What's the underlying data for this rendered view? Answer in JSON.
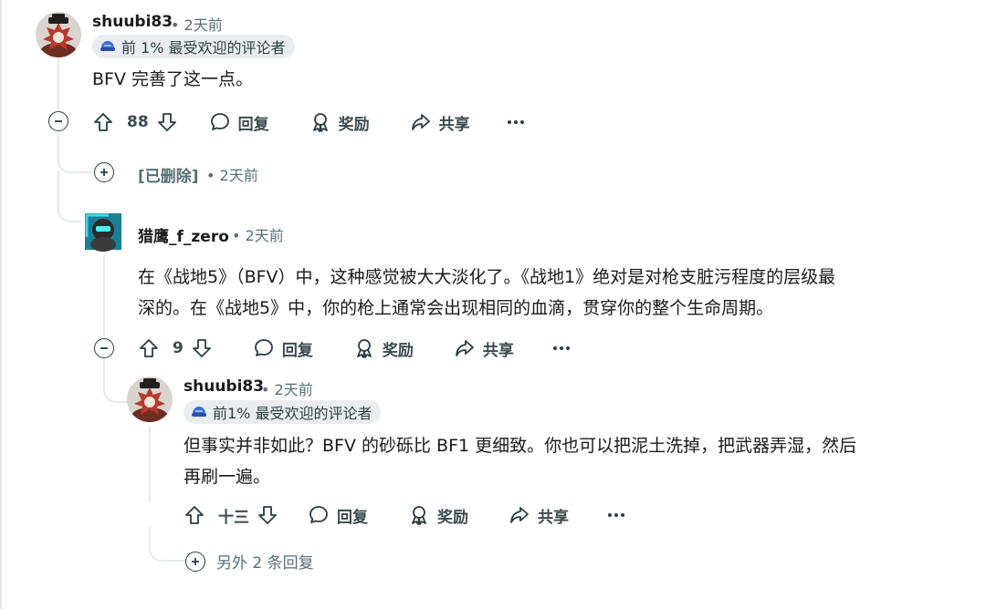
{
  "comments": [
    {
      "author": "shuubi83",
      "time": "• 2天前",
      "flair": "前 1% 最受欢迎的评论者",
      "body": "BFV 完善了这一点。",
      "votes": "88",
      "actions": {
        "reply": "回复",
        "award": "奖励",
        "share": "共享"
      }
    },
    {
      "deleted_label": "[已删除]",
      "time": "• 2天前"
    },
    {
      "author": "猎鹰_f_zero",
      "time": "• 2天前",
      "body_lines": [
        "在《战地5》（BFV）中，这种感觉被大大淡化了。《战地1》绝对是对枪支脏污程度的层级最",
        "深的。在《战地5》中，你的枪上通常会出现相同的血滴，贯穿你的整个生命周期。"
      ],
      "votes": "9",
      "actions": {
        "reply": "回复",
        "award": "奖励",
        "share": "共享"
      }
    },
    {
      "author": "shuubi83",
      "time": "• 2天前",
      "flair": "前1% 最受欢迎的评论者",
      "body_lines": [
        "但事实并非如此？BFV 的砂砾比 BF1 更细致。你也可以把泥土洗掉，把武器弄湿，然后",
        "再刷一遍。"
      ],
      "votes": "十三",
      "actions": {
        "reply": "回复",
        "award": "奖励",
        "share": "共享"
      }
    }
  ],
  "more_replies": "另外 2 条回复",
  "icons": {
    "upvote": "upvote-arrow-icon",
    "downvote": "downvote-arrow-icon",
    "reply": "speech-bubble-icon",
    "award": "award-ribbon-icon",
    "share": "share-arrow-icon",
    "more": "overflow-dots-icon",
    "collapse": "minus-circle-icon",
    "expand": "plus-circle-icon"
  },
  "colors": {
    "text": "#1a1a1b",
    "meta": "#576f76",
    "thread_line": "#e5e9ec",
    "flair_bg": "#eaedef"
  }
}
